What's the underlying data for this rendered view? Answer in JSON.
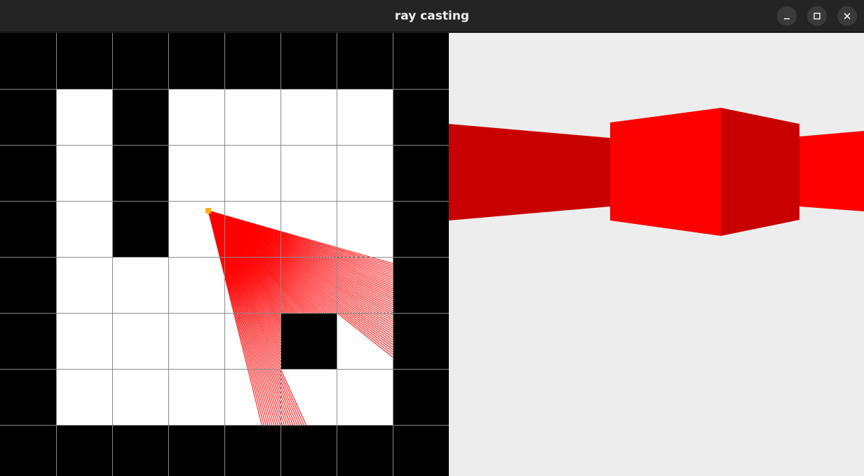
{
  "window": {
    "title": "ray casting",
    "controls": {
      "minimize_icon": "minimize-icon",
      "maximize_icon": "maximize-icon",
      "close_icon": "close-icon"
    }
  },
  "map": {
    "grid": [
      [
        1,
        1,
        1,
        1,
        1,
        1,
        1,
        1
      ],
      [
        1,
        0,
        1,
        0,
        0,
        0,
        0,
        1
      ],
      [
        1,
        0,
        1,
        0,
        0,
        0,
        0,
        1
      ],
      [
        1,
        0,
        1,
        0,
        0,
        0,
        0,
        1
      ],
      [
        1,
        0,
        0,
        0,
        0,
        0,
        0,
        1
      ],
      [
        1,
        0,
        0,
        0,
        0,
        1,
        0,
        1
      ],
      [
        1,
        0,
        0,
        0,
        0,
        0,
        0,
        1
      ],
      [
        1,
        1,
        1,
        1,
        1,
        1,
        1,
        1
      ]
    ],
    "colors": {
      "wall": "#000000",
      "floor": "#ffffff",
      "grid_line": "#8a8a8a",
      "player": "#ffb000",
      "ray": "#ff0000"
    }
  },
  "scene": {
    "colors": {
      "background": "#ededed",
      "wall_lit": "#ff0000",
      "wall_shaded": "#c80000"
    }
  }
}
